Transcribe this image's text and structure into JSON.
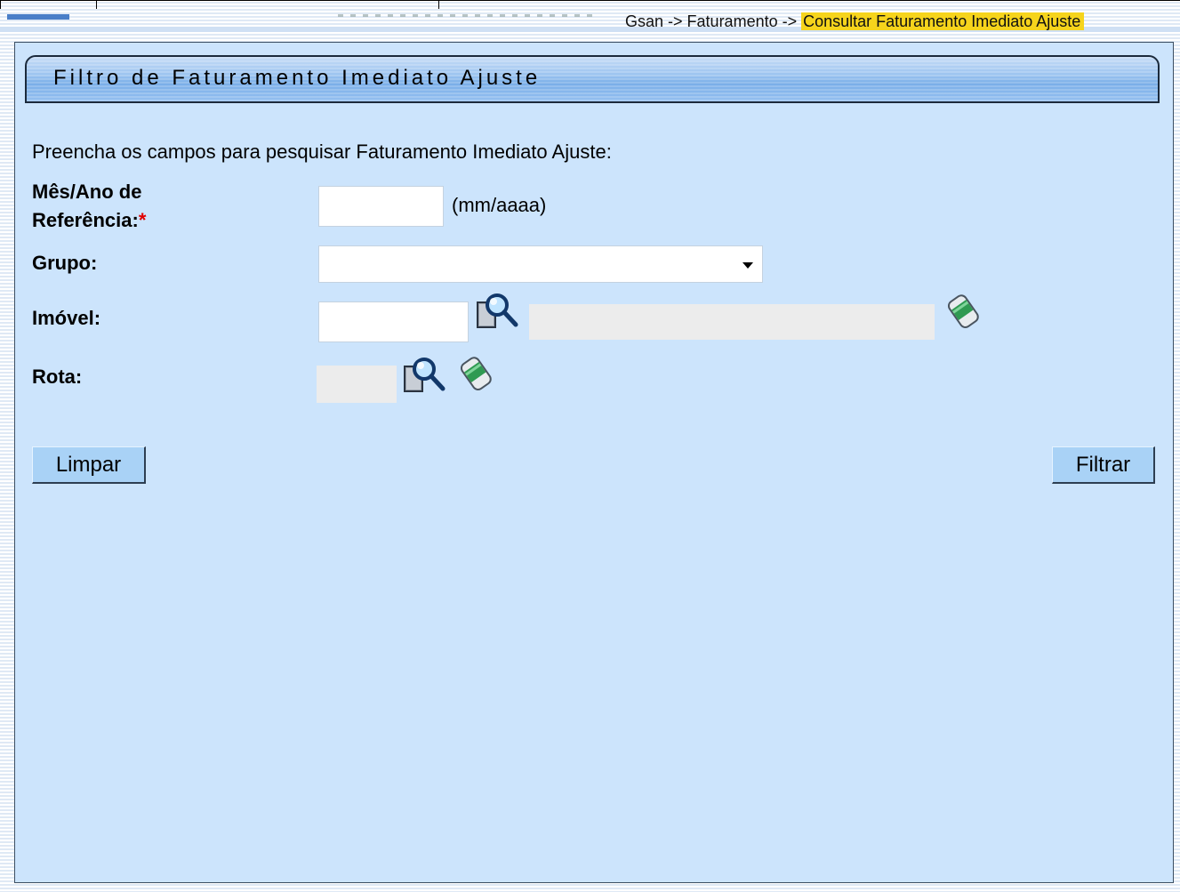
{
  "breadcrumb": {
    "root": "Gsan",
    "sep1": " -> ",
    "section": "Faturamento",
    "sep2": " -> ",
    "current": "Consultar Faturamento Imediato Ajuste"
  },
  "form": {
    "title": "Filtro de Faturamento Imediato Ajuste",
    "intro": "Preencha os campos para pesquisar Faturamento Imediato Ajuste:",
    "mes_ano": {
      "label_line1": "Mês/Ano de",
      "label_line2": "Referência:",
      "required_mark": "*",
      "value": "",
      "hint": "(mm/aaaa)"
    },
    "grupo": {
      "label": "Grupo:",
      "selected": ""
    },
    "imovel": {
      "label": "Imóvel:",
      "value": "",
      "description": ""
    },
    "rota": {
      "label": "Rota:",
      "value": ""
    }
  },
  "icons": {
    "search": "search-magnifier-icon",
    "eraser": "eraser-icon"
  },
  "buttons": {
    "limpar": "Limpar",
    "filtrar": "Filtrar"
  },
  "colors": {
    "panel_bg": "#cce4fc",
    "breadcrumb_highlight": "#f6d41c",
    "required": "#e00000",
    "button_bg": "#a9d2f6"
  }
}
